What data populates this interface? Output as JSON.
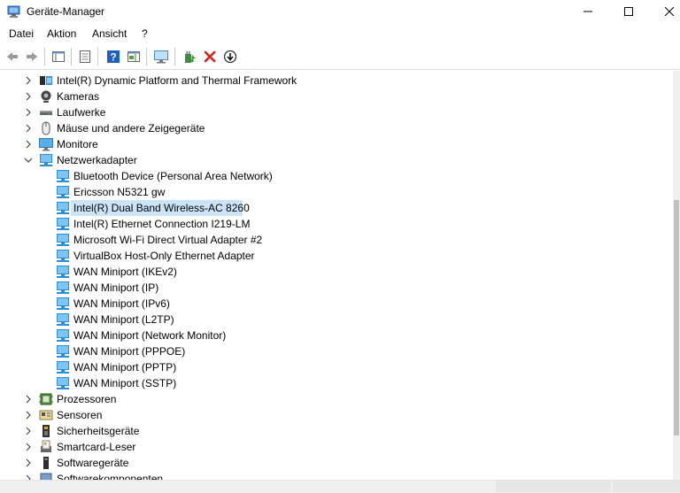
{
  "window": {
    "title": "Geräte-Manager",
    "minimize_glyph": "—",
    "close_glyph": "✕"
  },
  "menu": {
    "items": [
      "Datei",
      "Aktion",
      "Ansicht",
      "?"
    ]
  },
  "tree": {
    "items": [
      {
        "label": "Intel(R) Dynamic Platform and Thermal Framework",
        "icon": "chip-icon",
        "level": 0,
        "expanded": false
      },
      {
        "label": "Kameras",
        "icon": "camera-icon",
        "level": 0,
        "expanded": false
      },
      {
        "label": "Laufwerke",
        "icon": "drive-icon",
        "level": 0,
        "expanded": false
      },
      {
        "label": "Mäuse und andere Zeigegeräte",
        "icon": "mouse-icon",
        "level": 0,
        "expanded": false
      },
      {
        "label": "Monitore",
        "icon": "monitor-icon",
        "level": 0,
        "expanded": false
      },
      {
        "label": "Netzwerkadapter",
        "icon": "network-adapter-icon",
        "level": 0,
        "expanded": true
      },
      {
        "label": "Bluetooth Device (Personal Area Network)",
        "icon": "network-adapter-icon",
        "level": 1
      },
      {
        "label": "Ericsson N5321 gw",
        "icon": "network-adapter-icon",
        "level": 1
      },
      {
        "label": "Intel(R) Dual Band Wireless-AC 8260",
        "icon": "network-adapter-icon",
        "level": 1,
        "selected": true
      },
      {
        "label": "Intel(R) Ethernet Connection I219-LM",
        "icon": "network-adapter-icon",
        "level": 1
      },
      {
        "label": "Microsoft Wi-Fi Direct Virtual Adapter #2",
        "icon": "network-adapter-icon",
        "level": 1
      },
      {
        "label": "VirtualBox Host-Only Ethernet Adapter",
        "icon": "network-adapter-icon",
        "level": 1
      },
      {
        "label": "WAN Miniport (IKEv2)",
        "icon": "network-adapter-icon",
        "level": 1
      },
      {
        "label": "WAN Miniport (IP)",
        "icon": "network-adapter-icon",
        "level": 1
      },
      {
        "label": "WAN Miniport (IPv6)",
        "icon": "network-adapter-icon",
        "level": 1
      },
      {
        "label": "WAN Miniport (L2TP)",
        "icon": "network-adapter-icon",
        "level": 1
      },
      {
        "label": "WAN Miniport (Network Monitor)",
        "icon": "network-adapter-icon",
        "level": 1
      },
      {
        "label": "WAN Miniport (PPPOE)",
        "icon": "network-adapter-icon",
        "level": 1
      },
      {
        "label": "WAN Miniport (PPTP)",
        "icon": "network-adapter-icon",
        "level": 1
      },
      {
        "label": "WAN Miniport (SSTP)",
        "icon": "network-adapter-icon",
        "level": 1
      },
      {
        "label": "Prozessoren",
        "icon": "processor-icon",
        "level": 0,
        "expanded": false
      },
      {
        "label": "Sensoren",
        "icon": "sensor-icon",
        "level": 0,
        "expanded": false
      },
      {
        "label": "Sicherheitsgeräte",
        "icon": "security-device-icon",
        "level": 0,
        "expanded": false
      },
      {
        "label": "Smartcard-Leser",
        "icon": "smartcard-reader-icon",
        "level": 0,
        "expanded": false
      },
      {
        "label": "Softwaregeräte",
        "icon": "software-device-icon",
        "level": 0,
        "expanded": false
      },
      {
        "label": "Softwarekomponenten",
        "icon": "software-component-icon",
        "level": 0,
        "expanded": false
      }
    ]
  },
  "colors": {
    "selection": "#cce4f7",
    "network_icon": "#2b8fd6",
    "uninstall_red": "#d9201c"
  }
}
